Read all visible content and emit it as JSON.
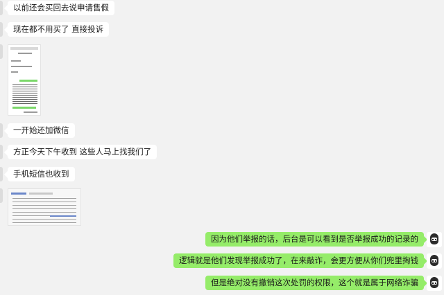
{
  "messages": {
    "m1": "以前还会买回去说申请售假",
    "m2": "现在都不用买了 直接投诉",
    "m3": "一开始还加微信",
    "m4": "方正今天下午收到 这些人马上找我们了",
    "m5": "手机短信也收到",
    "m6": "因为他们举报的话，后台是可以看到是否举报成功的记录的",
    "m7": "逻辑就是他们发现举报成功了，在来敲诈，会更方便从你们兜里掏钱",
    "m8": "但是绝对没有撤销这次处罚的权限，这个就是属于网络诈骗"
  },
  "colors": {
    "background": "#f2f2f2",
    "incoming_bubble": "#ffffff",
    "outgoing_bubble": "#95ec69"
  },
  "icons": {
    "self_avatar": "cartoon-face-avatar"
  }
}
